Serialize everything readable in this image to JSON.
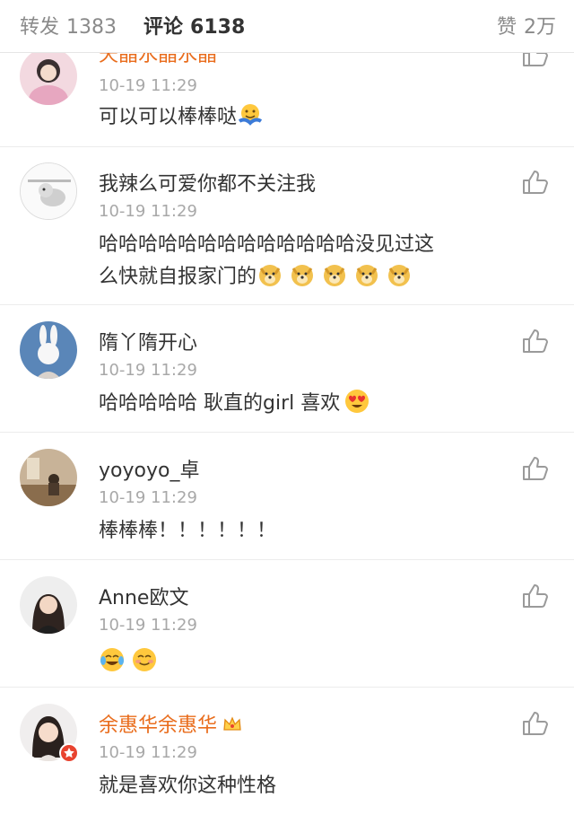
{
  "tabs": {
    "repost": {
      "label": "转发",
      "count": "1383"
    },
    "comment": {
      "label": "评论",
      "count": "6138"
    },
    "like": {
      "label": "赞",
      "count": "2万"
    }
  },
  "comments": [
    {
      "name": "天晶水晶水晶",
      "time": "10-19 11:29",
      "text": "可以可以棒棒哒",
      "emoji": [
        "hug-emoji"
      ]
    },
    {
      "name": "我辣么可爱你都不关注我",
      "time": "10-19 11:29",
      "text_line1": "哈哈哈哈哈哈哈哈哈哈哈哈哈没见过这",
      "text_line2": "么快就自报家门的",
      "emoji": [
        "doge-emoji",
        "doge-emoji",
        "doge-emoji",
        "doge-emoji",
        "doge-emoji"
      ]
    },
    {
      "name": "隋丫隋开心",
      "time": "10-19 11:29",
      "text": "哈哈哈哈哈 耿直的girl 喜欢",
      "emoji": [
        "heart-eyes-emoji"
      ]
    },
    {
      "name": "yoyoyo_卓",
      "time": "10-19 11:29",
      "text": "棒棒棒！！！！！！",
      "emoji": []
    },
    {
      "name": "Anne欧文",
      "time": "10-19 11:29",
      "text": "",
      "emoji": [
        "tears-of-joy-emoji",
        "smile-emoji"
      ]
    },
    {
      "name": "余惠华余惠华",
      "time": "10-19 11:29",
      "text": "就是喜欢你这种性格",
      "emoji": [],
      "vip": true
    }
  ],
  "colors": {
    "vip_name": "#e96d1d",
    "badge": "#e8432f",
    "muted": "#a8a8a8"
  }
}
